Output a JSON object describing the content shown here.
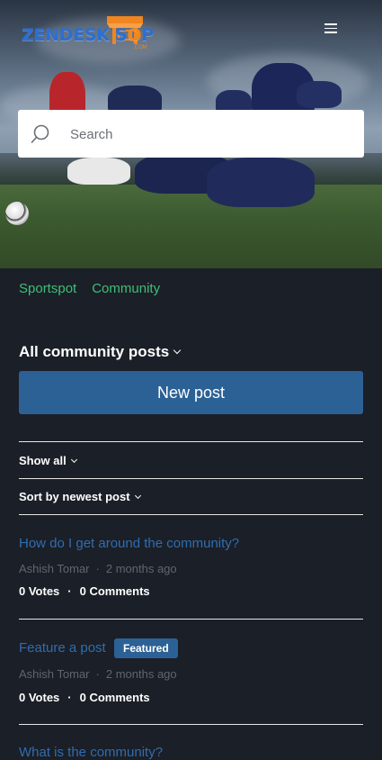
{
  "header": {
    "logo_text_a": "ZENDESK S",
    "logo_text_b": "P",
    "logo_sub": ".COM",
    "brand_color": "#2a6fd6",
    "accent_color": "#f0861f"
  },
  "search": {
    "placeholder": "Search"
  },
  "breadcrumb": [
    {
      "label": "Sportspot"
    },
    {
      "label": "Community"
    }
  ],
  "page": {
    "title": "All community posts",
    "new_post_label": "New post",
    "filter_show": "Show all",
    "filter_sort": "Sort by newest post"
  },
  "posts": [
    {
      "title": "How do I get around the community?",
      "author": "Ashish Tomar",
      "time": "2 months ago",
      "votes": "0 Votes",
      "comments": "0 Comments"
    },
    {
      "title": "Feature a post",
      "badge": "Featured",
      "author": "Ashish Tomar",
      "time": "2 months ago",
      "votes": "0 Votes",
      "comments": "0 Comments"
    },
    {
      "title": "What is the community?"
    }
  ],
  "meta_separator": "·",
  "stats_separator": "·",
  "colors": {
    "link_green": "#3fbf76",
    "link_blue": "#2f6db0",
    "button_blue": "#2c6196",
    "background": "#1b1f27"
  }
}
